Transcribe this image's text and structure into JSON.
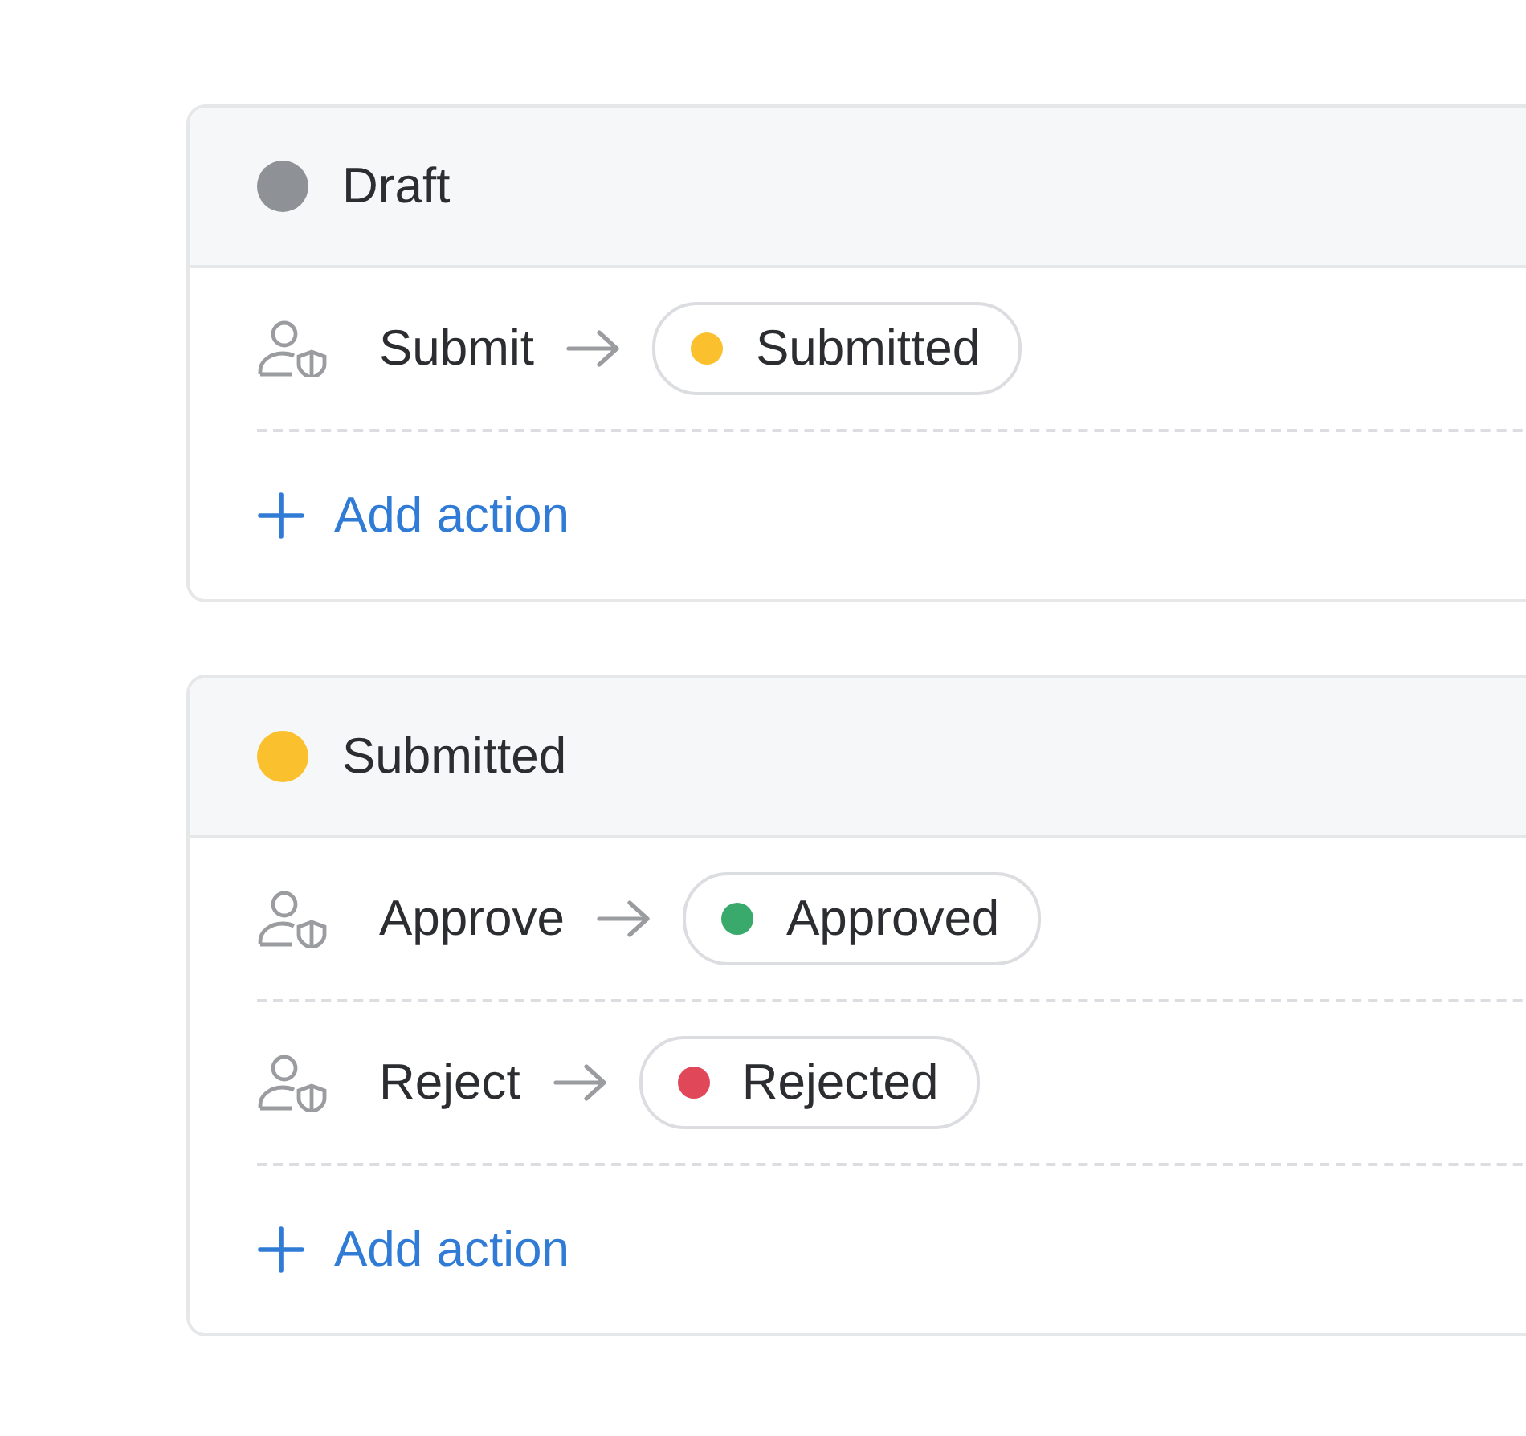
{
  "states": [
    {
      "name": "Draft",
      "color": "#8e9196",
      "actions": [
        {
          "label": "Submit",
          "target": {
            "name": "Submitted",
            "color": "#fbc02d"
          }
        }
      ],
      "add_label": "Add action"
    },
    {
      "name": "Submitted",
      "color": "#fbc02d",
      "actions": [
        {
          "label": "Approve",
          "target": {
            "name": "Approved",
            "color": "#3aaa6c"
          }
        },
        {
          "label": "Reject",
          "target": {
            "name": "Rejected",
            "color": "#e0485a"
          }
        }
      ],
      "add_label": "Add action"
    }
  ]
}
